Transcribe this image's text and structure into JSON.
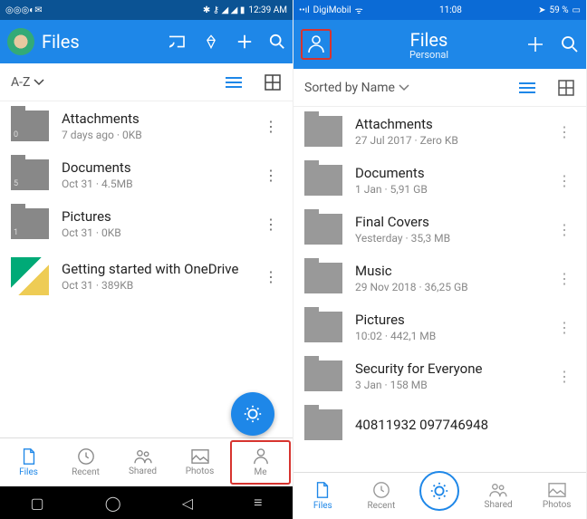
{
  "android": {
    "statusbar": {
      "time": "12:39 AM"
    },
    "header": {
      "title": "Files"
    },
    "sort": {
      "label": "A-Z"
    },
    "items": [
      {
        "name": "Attachments",
        "meta": "7 days ago · 0KB",
        "count": "0"
      },
      {
        "name": "Documents",
        "meta": "Oct 31 · 4.5MB",
        "count": "5"
      },
      {
        "name": "Pictures",
        "meta": "Oct 31 · 0KB",
        "count": "1"
      },
      {
        "name": "Getting started with OneDrive",
        "meta": "Oct 31 · 389KB"
      }
    ],
    "nav": {
      "files": "Files",
      "recent": "Recent",
      "shared": "Shared",
      "photos": "Photos",
      "me": "Me"
    }
  },
  "ios": {
    "statusbar": {
      "carrier": "DigiMobil",
      "time": "11:08",
      "battery": "59 %"
    },
    "header": {
      "title": "Files",
      "subtitle": "Personal"
    },
    "sort": {
      "label": "Sorted by Name"
    },
    "items": [
      {
        "name": "Attachments",
        "meta": "27 Jul 2017 · Zero KB"
      },
      {
        "name": "Documents",
        "meta": "1 Jan · 5,91 GB"
      },
      {
        "name": "Final Covers",
        "meta": "Yesterday · 35,3 MB"
      },
      {
        "name": "Music",
        "meta": "29 Nov 2018 · 36,25 GB"
      },
      {
        "name": "Pictures",
        "meta": "10:02 · 442,1 MB"
      },
      {
        "name": "Security for Everyone",
        "meta": "3 Jan · 158 MB"
      },
      {
        "name": "40811932    097746948",
        "meta": ""
      }
    ],
    "nav": {
      "files": "Files",
      "recent": "Recent",
      "shared": "Shared",
      "photos": "Photos"
    }
  }
}
